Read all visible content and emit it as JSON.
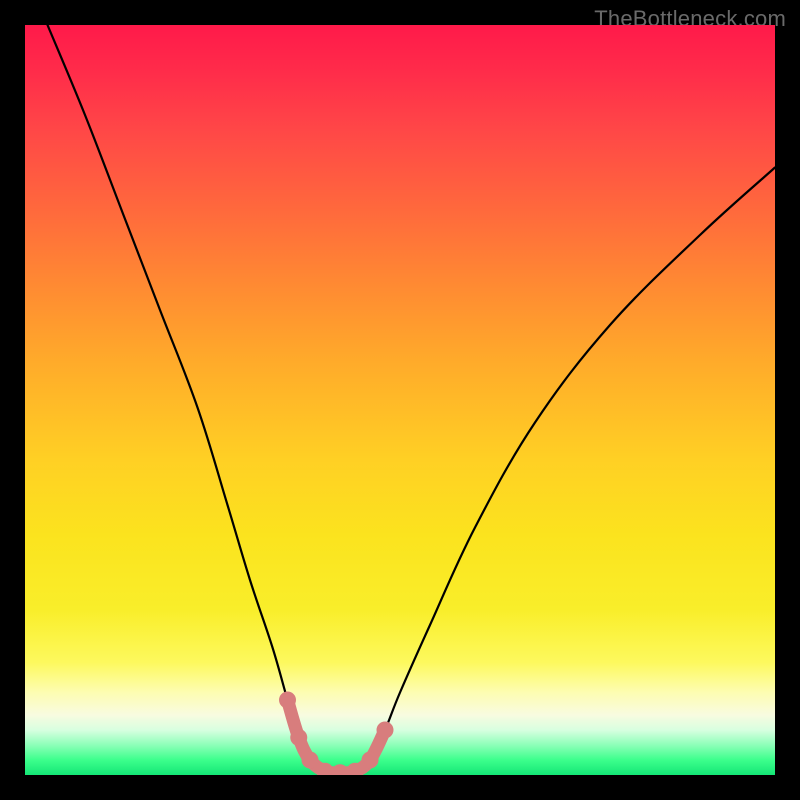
{
  "watermark": "TheBottleneck.com",
  "chart_data": {
    "type": "line",
    "title": "",
    "xlabel": "",
    "ylabel": "",
    "xlim": [
      0,
      100
    ],
    "ylim": [
      0,
      100
    ],
    "series": [
      {
        "name": "bottleneck-curve",
        "x": [
          3,
          8,
          13,
          18,
          23,
          27,
          30,
          33,
          35,
          36.5,
          38,
          40,
          42,
          44,
          46,
          48,
          50,
          54,
          60,
          68,
          78,
          90,
          100
        ],
        "values": [
          100,
          88,
          75,
          62,
          49,
          36,
          26,
          17,
          10,
          5,
          2,
          0.5,
          0.3,
          0.5,
          2,
          6,
          11,
          20,
          33,
          47,
          60,
          72,
          81
        ]
      }
    ],
    "valley_marker": {
      "name": "optimal-zone",
      "x": [
        35,
        36.5,
        38,
        40,
        42,
        44,
        46,
        48
      ],
      "values": [
        10,
        5,
        2,
        0.5,
        0.3,
        0.5,
        2,
        6
      ],
      "color": "#d87d7d"
    },
    "gradient_meaning": "vertical position maps to bottleneck severity; top = high (red), bottom = low (green)"
  }
}
